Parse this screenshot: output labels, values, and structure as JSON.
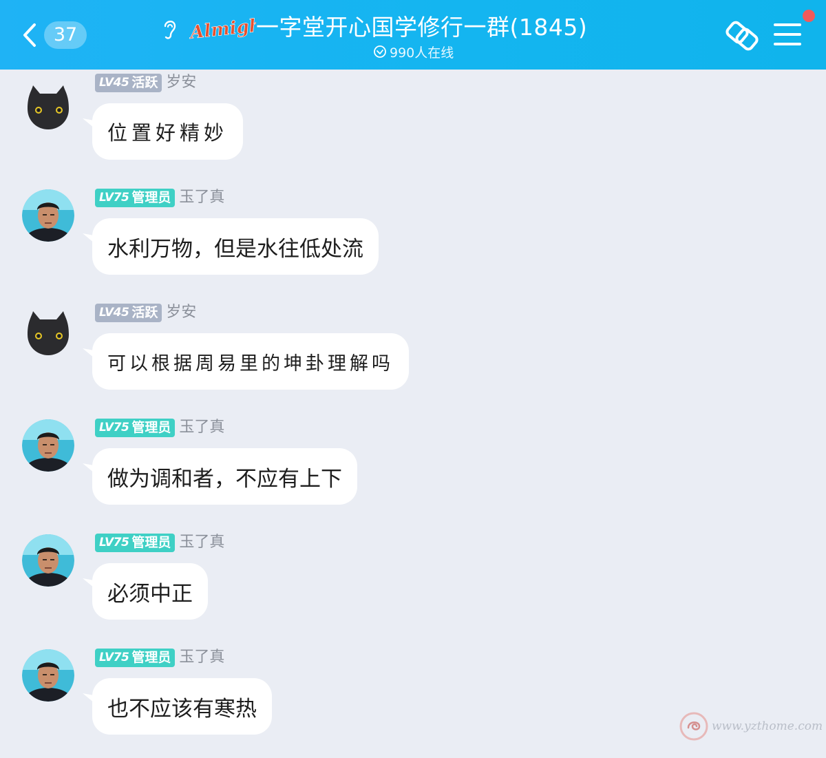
{
  "header": {
    "unread_count": "37",
    "logo_text": "Almighty",
    "group_title": "一字堂开心国学修行一群(1845)",
    "online_text": "990人在线",
    "colors": {
      "bar": "#14b5f0",
      "notify_dot": "#f25a5a"
    }
  },
  "messages": [
    {
      "level": "LV45",
      "role": "活跃",
      "nickname": "岁安",
      "text": "位置好精妙",
      "avatar": "cat"
    },
    {
      "level": "LV75",
      "role": "管理员",
      "nickname": "玉了真",
      "text": "水利万物，但是水往低处流",
      "avatar": "man"
    },
    {
      "level": "LV45",
      "role": "活跃",
      "nickname": "岁安",
      "text": "可以根据周易里的坤卦理解吗",
      "avatar": "cat"
    },
    {
      "level": "LV75",
      "role": "管理员",
      "nickname": "玉了真",
      "text": "做为调和者，不应有上下",
      "avatar": "man"
    },
    {
      "level": "LV75",
      "role": "管理员",
      "nickname": "玉了真",
      "text": "必须中正",
      "avatar": "man"
    },
    {
      "level": "LV75",
      "role": "管理员",
      "nickname": "玉了真",
      "text": "也不应该有寒热",
      "avatar": "man"
    }
  ],
  "watermark": {
    "text": "www.yzthome.com"
  }
}
